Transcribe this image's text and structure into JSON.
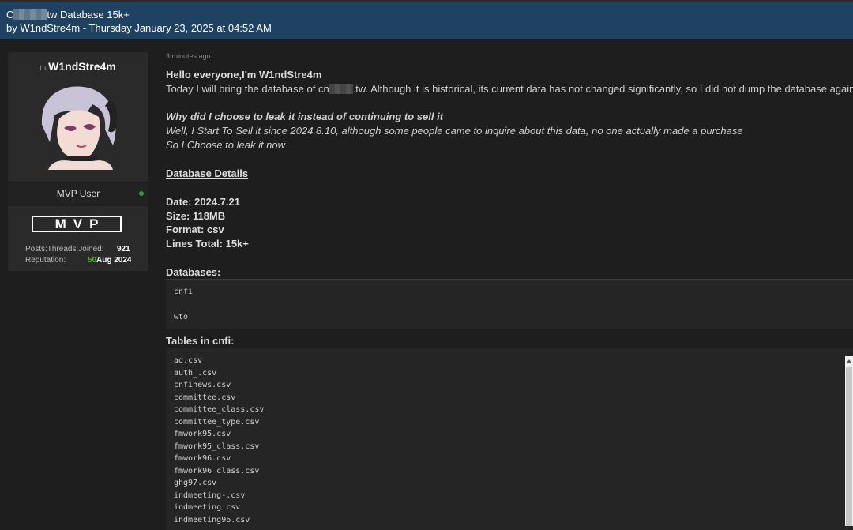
{
  "header": {
    "title_prefix": "C",
    "title_suffix": "tw Database 15k+",
    "byline": "by W1ndStre4m - Thursday January 23, 2025 at 04:52 AM"
  },
  "user": {
    "name": "W1ndStre4m",
    "role": "MVP User",
    "badge": "MVP",
    "stats_labels": "Posts:Threads:Joined:",
    "posts": "921",
    "reputation_label": "Reputation:",
    "reputation": "50",
    "joined": "Aug 2024"
  },
  "post": {
    "time": "3 minutes ago",
    "greeting": "Hello everyone,I'm W1ndStre4m",
    "intro_prefix": "Today I will bring the database of cn",
    "intro_suffix": ".tw. Although it is historical, its current data has not changed significantly, so I did not dump the database again.",
    "why_heading": "Why did I choose to leak it instead of continuing to sell it",
    "why_line1": "Well, I Start To Sell it since 2024.8.10, although some people came to inquire about this data, no one actually made a purchase",
    "why_line2": "So I Choose to leak it now",
    "details_heading": "Database Details",
    "date": "Date: 2024.7.21",
    "size": "Size: 118MB",
    "format": "Format: csv",
    "lines": "Lines Total: 15k+",
    "databases_label": "Databases:",
    "databases": [
      "cnfi",
      "wto"
    ],
    "tables_label": "Tables in cnfi:",
    "tables": [
      "ad.csv",
      "auth_.csv",
      "cnfinews.csv",
      "committee.csv",
      "committee_class.csv",
      "committee_type.csv",
      "fmwork95.csv",
      "fmwork95_class.csv",
      "fmwork96.csv",
      "fmwork96_class.csv",
      "ghg97.csv",
      "indmeeting-.csv",
      "indmeeting.csv",
      "indmeeting96.csv"
    ]
  },
  "colors": {
    "header_bg": "#1f4263",
    "page_bg": "#1e1e1e",
    "reputation_green": "#2fbf2f"
  }
}
